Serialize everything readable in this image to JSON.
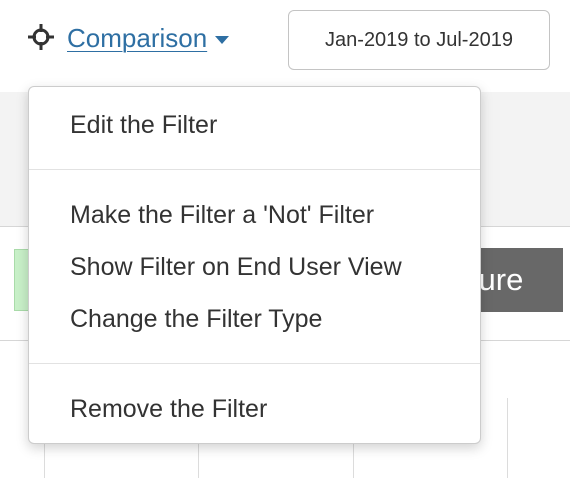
{
  "header": {
    "filter_label": "Comparison",
    "date_range": "Jan-2019 to Jul-2019"
  },
  "menu": {
    "items": [
      {
        "label": "Edit the Filter"
      },
      {
        "label": "Make the Filter a 'Not' Filter"
      },
      {
        "label": "Show Filter on End User View"
      },
      {
        "label": "Change the Filter Type"
      },
      {
        "label": "Remove the Filter"
      }
    ]
  },
  "background": {
    "partial_button_text": "sure"
  },
  "colors": {
    "link": "#2e6fa3",
    "menu_text": "#333333",
    "dark_button": "#686868",
    "green_chip": "#c8f0c8"
  },
  "icons": {
    "filter_icon": "crosshair-icon",
    "dropdown_icon": "caret-down-icon"
  }
}
